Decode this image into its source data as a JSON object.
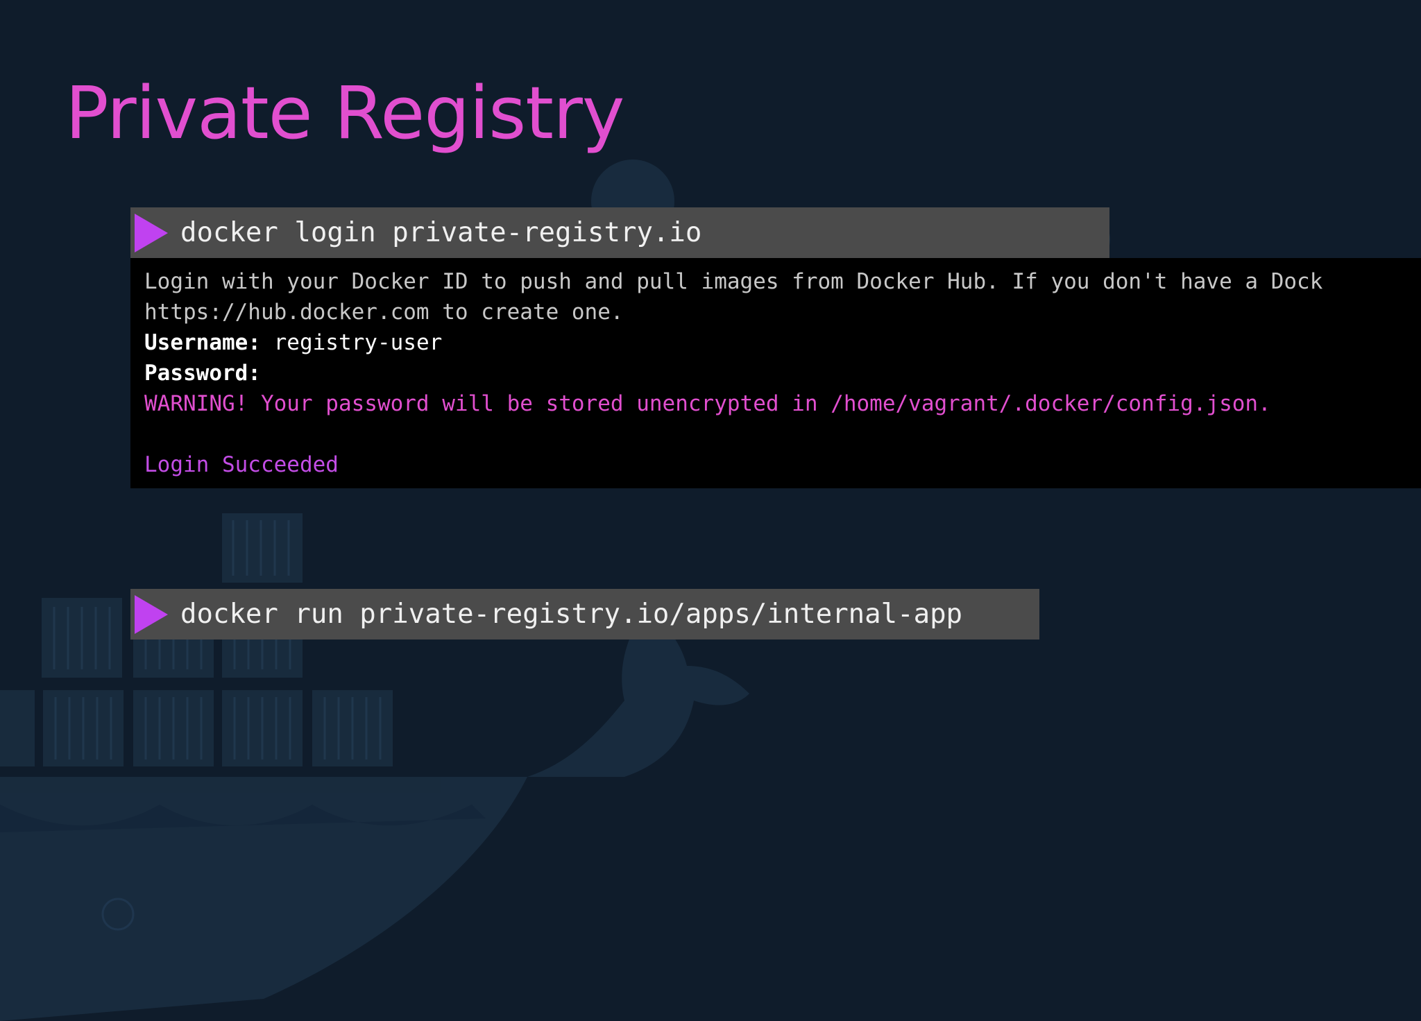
{
  "slide": {
    "title": "Private Registry"
  },
  "login_command": {
    "text": "docker login private-registry.io"
  },
  "terminal_output": {
    "line1": "Login with your Docker ID to push and pull images from Docker Hub. If you don't have a Dock",
    "line2": "https://hub.docker.com to create one.",
    "username_label": "Username:",
    "username_value": " registry-user",
    "password_label": "Password:",
    "warning": "WARNING! Your password will be stored unencrypted in /home/vagrant/.docker/config.json.",
    "success": "Login Succeeded"
  },
  "run_command": {
    "text": "docker run private-registry.io/apps/internal-app"
  },
  "icons": {
    "prompt": "play-triangle-icon",
    "background": "docker-whale-icon"
  },
  "colors": {
    "background": "#0f1c2b",
    "title": "#e14fcf",
    "command_bar": "#4b4b4b",
    "play_icon": "#c042f0",
    "terminal_bg": "#000000",
    "warning": "#e14fcf",
    "success": "#c34de6"
  }
}
